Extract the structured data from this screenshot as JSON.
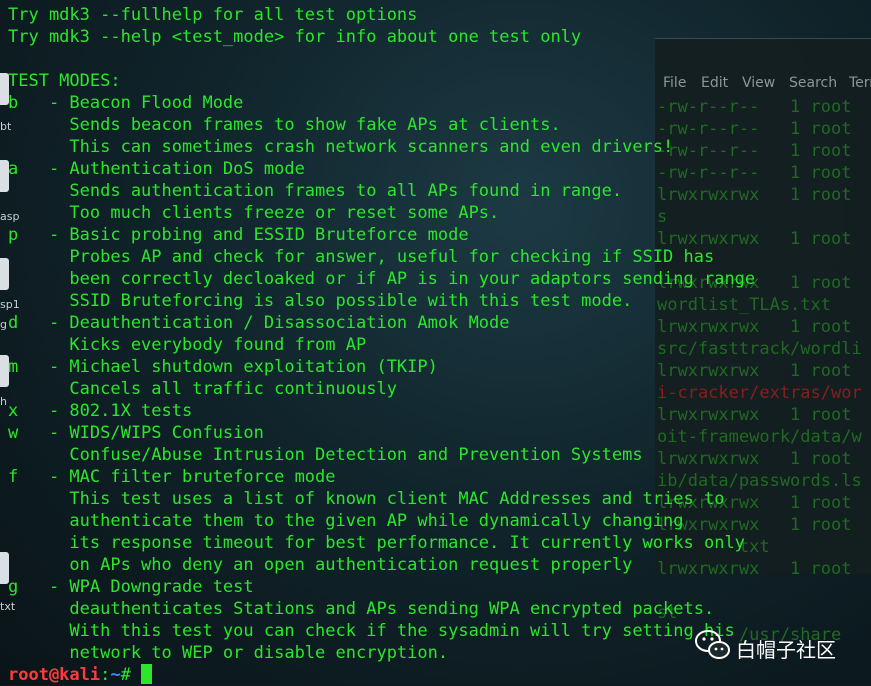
{
  "main_terminal": {
    "lines": [
      "Try mdk3 --fullhelp for all test options",
      "Try mdk3 --help <test_mode> for info about one test only",
      "",
      "TEST MODES:",
      "b   - Beacon Flood Mode",
      "      Sends beacon frames to show fake APs at clients.",
      "      This can sometimes crash network scanners and even drivers!",
      "a   - Authentication DoS mode",
      "      Sends authentication frames to all APs found in range.",
      "      Too much clients freeze or reset some APs.",
      "p   - Basic probing and ESSID Bruteforce mode",
      "      Probes AP and check for answer, useful for checking if SSID has",
      "      been correctly decloaked or if AP is in your adaptors sending range",
      "      SSID Bruteforcing is also possible with this test mode.",
      "d   - Deauthentication / Disassociation Amok Mode",
      "      Kicks everybody found from AP",
      "m   - Michael shutdown exploitation (TKIP)",
      "      Cancels all traffic continuously",
      "x   - 802.1X tests",
      "w   - WIDS/WIPS Confusion",
      "      Confuse/Abuse Intrusion Detection and Prevention Systems",
      "f   - MAC filter bruteforce mode",
      "      This test uses a list of known client MAC Addresses and tries to",
      "      authenticate them to the given AP while dynamically changing",
      "      its response timeout for best performance. It currently works only",
      "      on APs who deny an open authentication request properly",
      "g   - WPA Downgrade test",
      "      deauthenticates Stations and APs sending WPA encrypted packets.",
      "      With this test you can check if the sysadmin will try setting his",
      "      network to WEP or disable encryption."
    ],
    "prompt": {
      "user_host": "root@kali",
      "separator": ":",
      "path": "~",
      "symbol": "# "
    }
  },
  "background_terminal": {
    "menu": [
      "File",
      "Edit",
      "View",
      "Search",
      "Terminal"
    ],
    "lines": [
      {
        "text": "-rw-r--r--   1 root",
        "color": "green"
      },
      {
        "text": "-rw-r--r--   1 root",
        "color": "green"
      },
      {
        "text": "-rw-r--r--   1 root",
        "color": "green"
      },
      {
        "text": "-rw-r--r--   1 root",
        "color": "green"
      },
      {
        "text": "lrwxrwxrwx   1 root",
        "color": "green"
      },
      {
        "text": "s",
        "color": "green"
      },
      {
        "text": "lrwxrwxrwx   1 root",
        "color": "green"
      },
      {
        "text": "",
        "color": "green"
      },
      {
        "text": "lrwxrwxrwx   1 root",
        "color": "green"
      },
      {
        "text": "wordlist_TLAs.txt",
        "color": "green"
      },
      {
        "text": "lrwxrwxrwx   1 root",
        "color": "green"
      },
      {
        "text": "src/fasttrack/wordli",
        "color": "green"
      },
      {
        "text": "lrwxrwxrwx   1 root",
        "color": "green"
      },
      {
        "text": "i-cracker/extras/wor",
        "color": "red"
      },
      {
        "text": "lrwxrwxrwx   1 root",
        "color": "green"
      },
      {
        "text": "oit-framework/data/w",
        "color": "green"
      },
      {
        "text": "lrwxrwxrwx   1 root",
        "color": "green"
      },
      {
        "text": "ib/data/passwords.ls",
        "color": "green"
      },
      {
        "text": "lrwxrwxrwx   1 root",
        "color": "green"
      },
      {
        "text": "lrwxrwxrwx   1 root",
        "color": "green"
      },
      {
        "text": "        txt",
        "color": "green"
      },
      {
        "text": "lrwxrwxrwx   1 root",
        "color": "green"
      },
      {
        "text": "",
        "color": "green"
      },
      {
        "text": "st",
        "color": "green"
      },
      {
        "text": "        /usr/share",
        "color": "green"
      }
    ]
  },
  "desktop_icons": [
    {
      "name": "file-icon",
      "label": "bt"
    },
    {
      "name": "file-icon",
      "label": "asp"
    },
    {
      "name": "file-icon",
      "label": "sp1"
    },
    {
      "name": "file-icon",
      "label": "g"
    },
    {
      "name": "folder-icon",
      "label": "h"
    },
    {
      "name": "file-icon",
      "label": "txt"
    }
  ],
  "watermark": {
    "icon": "wechat-icon",
    "text": "白帽子社区"
  },
  "colors": {
    "terminal_green": "#2ce62c",
    "prompt_user": "#ff3a3a",
    "prompt_path": "#3a8cff",
    "background": "#0d1a1f"
  }
}
